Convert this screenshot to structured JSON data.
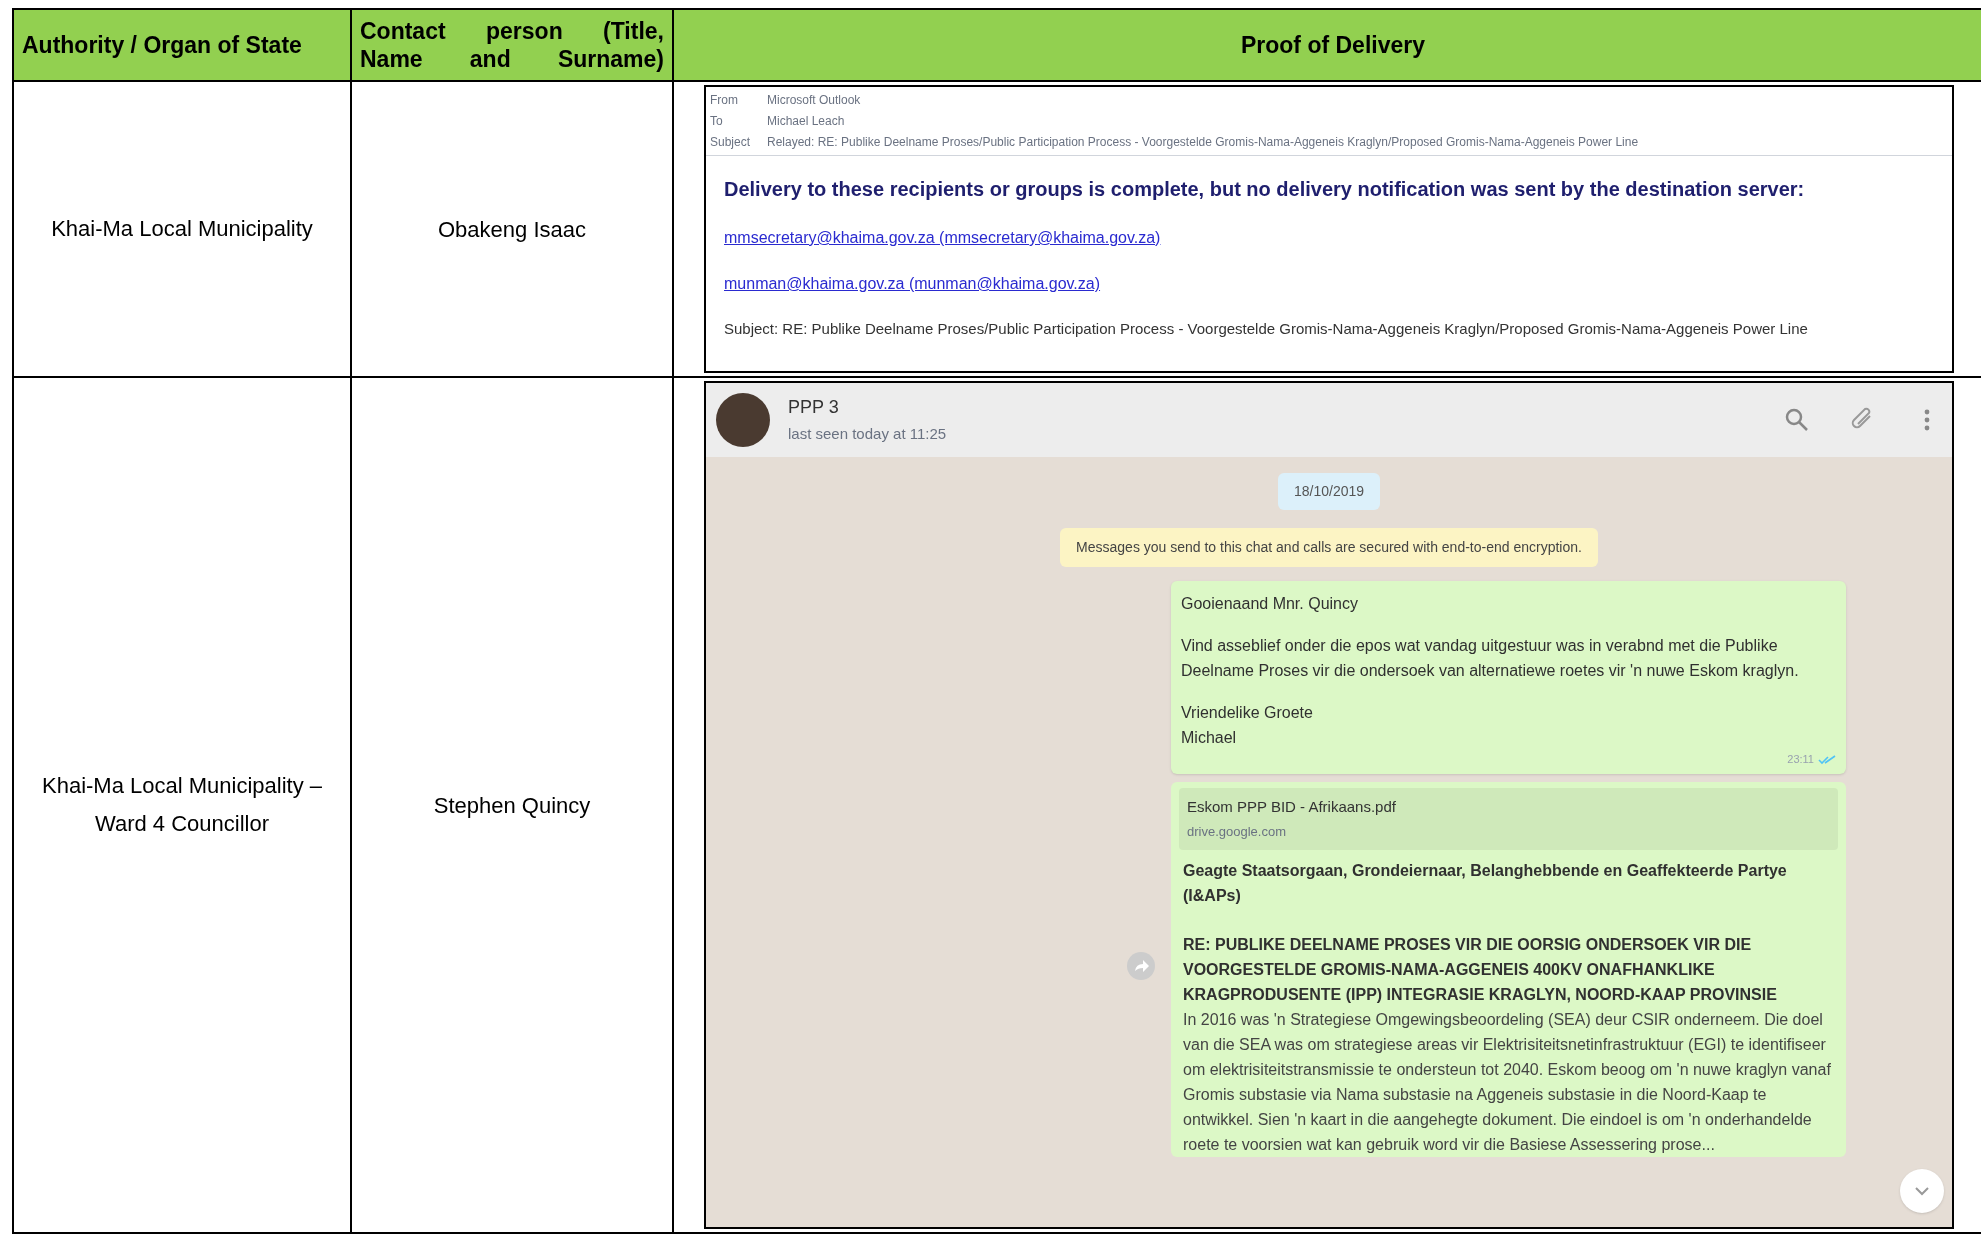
{
  "table": {
    "columns": [
      "Authority / Organ of State",
      "Contact person (Title, Name and Surname)",
      "Proof of Delivery"
    ],
    "rows": [
      {
        "authority": "Khai-Ma Local Municipality",
        "contact": "Obakeng Isaac",
        "proof": {
          "kind": "email",
          "fields": [
            {
              "label": "From",
              "value": "Microsoft Outlook"
            },
            {
              "label": "To",
              "value": "Michael Leach"
            },
            {
              "label": "Subject",
              "value": "Relayed: RE: Publike Deelname Proses/Public Participation Process - Voorgestelde Gromis-Nama-Aggeneis Kraglyn/Proposed Gromis-Nama-Aggeneis Power Line"
            }
          ],
          "heading": "Delivery to these recipients or groups is complete, but no delivery notification was sent by the destination server:",
          "links": [
            "mmsecretary@khaima.gov.za (mmsecretary@khaima.gov.za)",
            "munman@khaima.gov.za (munman@khaima.gov.za)"
          ],
          "subject_line": "Subject: RE: Publike Deelname Proses/Public Participation Process - Voorgestelde Gromis-Nama-Aggeneis Kraglyn/Proposed Gromis-Nama-Aggeneis Power Line"
        }
      },
      {
        "authority": "Khai-Ma Local Municipality – Ward 4 Councillor",
        "contact": "Stephen Quincy",
        "proof": {
          "kind": "chat",
          "contact_name": "PPP 3",
          "last_seen": "last seen today at 11:25",
          "date": "18/10/2019",
          "notice": "Messages you send to this chat and calls are secured with end-to-end encryption.",
          "messages": [
            {
              "kind": "text",
              "paragraphs": [
                "Gooienaand Mnr. Quincy",
                "Vind asseblief onder die epos wat vandag uitgestuur was in verabnd met die Publike Deelname Proses vir die ondersoek van alternatiewe roetes vir 'n nuwe Eskom kraglyn.",
                "Vriendelike Groete\nMichael"
              ],
              "time": "23:11",
              "read": true
            },
            {
              "kind": "link",
              "title": "Eskom PPP BID - Afrikaans.pdf",
              "domain": "drive.google.com",
              "salutation": "Geagte Staatsorgaan, Grondeiernaar, Belanghebbende en Geaffekteerde Partye (I&APs)",
              "heading": "RE: PUBLIKE DEELNAME PROSES VIR DIE OORSIG ONDERSOEK VIR DIE VOORGESTELDE GROMIS-NAMA-AGGENEIS 400KV ONAFHANKLIKE KRAGPRODUSENTE (IPP) INTEGRASIE KRAGLYN, NOORD-KAAP PROVINSIE",
              "body": "In 2016 was 'n Strategiese Omgewingsbeoordeling (SEA) deur CSIR onderneem. Die doel van die SEA was om strategiese areas vir Elektrisiteitsnetinfrastruktuur (EGI) te identifiseer om elektrisiteitstransmissie te ondersteun tot 2040. Eskom beoog om 'n nuwe kraglyn vanaf Gromis substasie via Nama substasie na Aggeneis substasie in die Noord-Kaap te ontwikkel. Sien 'n kaart in die aangehegte dokument. Die eindoel is om 'n onderhandelde roete te voorsien wat kan gebruik word vir die Basiese Assessering prose..."
            }
          ]
        }
      }
    ]
  }
}
